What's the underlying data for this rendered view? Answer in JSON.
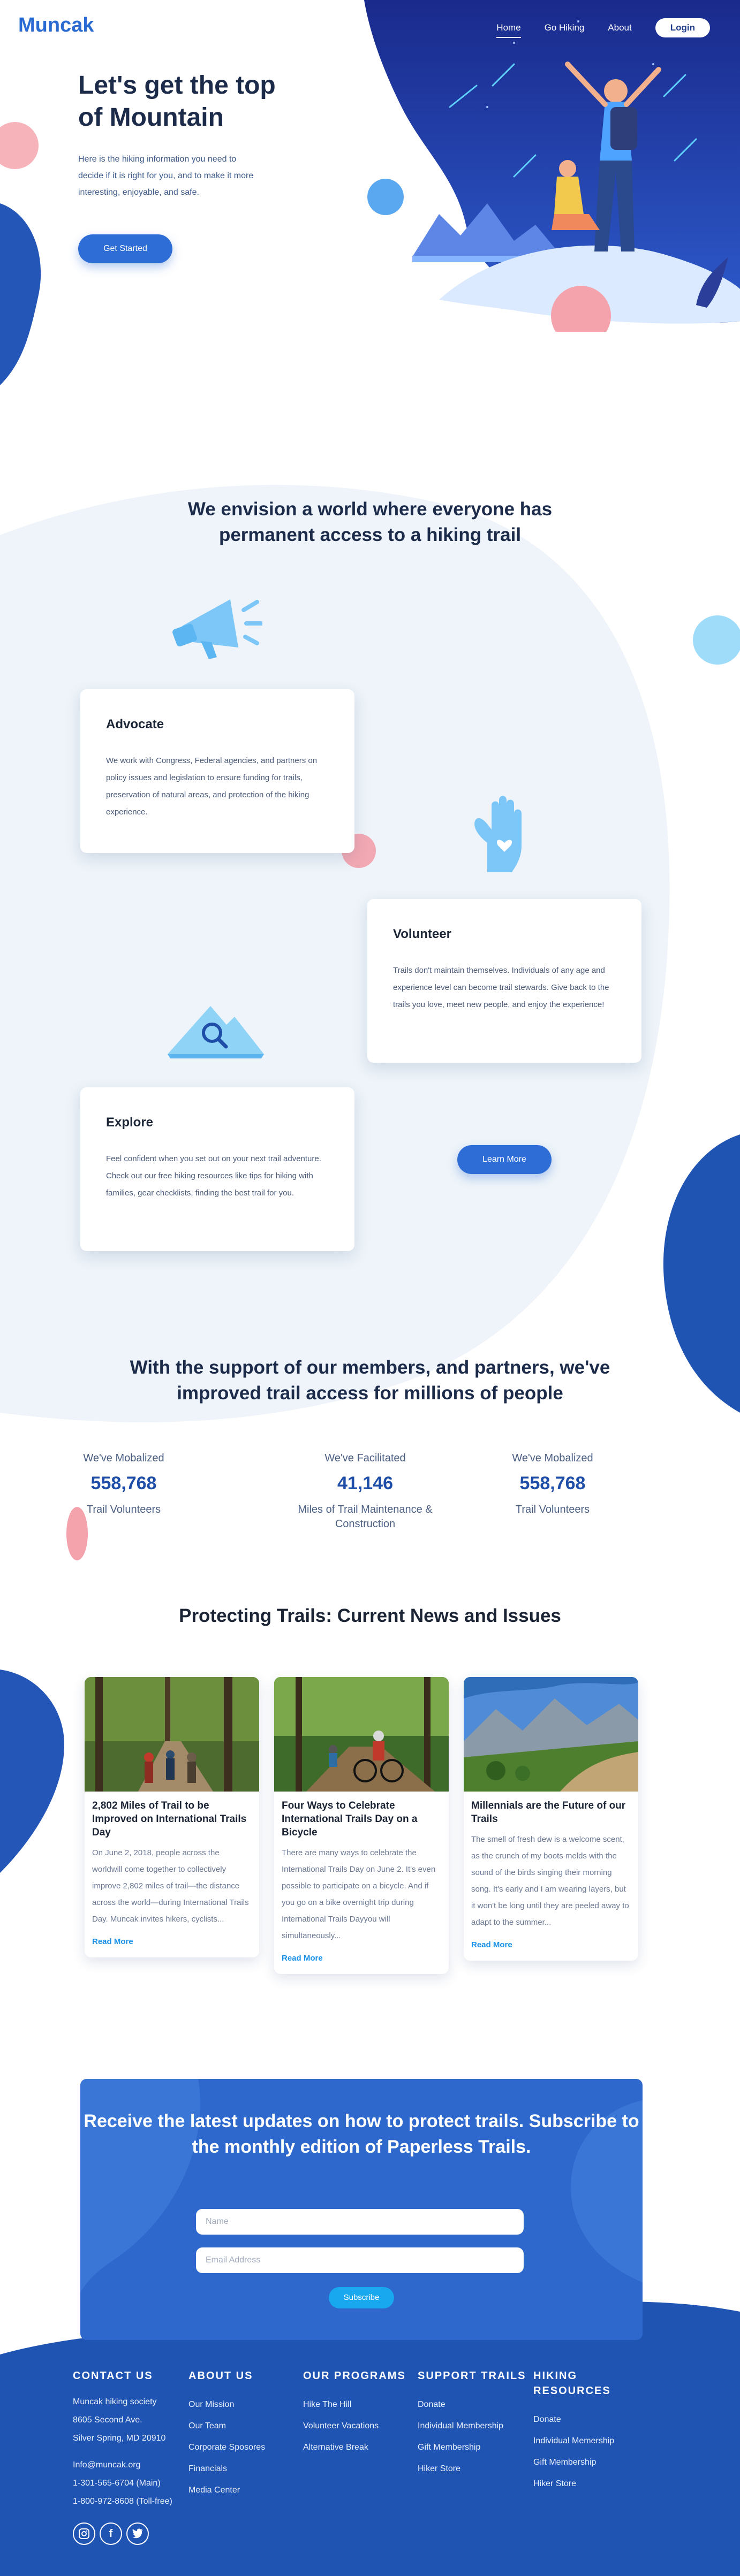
{
  "brand": {
    "name": "Muncak"
  },
  "nav": {
    "items": [
      {
        "label": "Home",
        "active": true
      },
      {
        "label": "Go Hiking"
      },
      {
        "label": "About"
      }
    ],
    "login_label": "Login"
  },
  "hero": {
    "title": "Let's get the top of Mountain",
    "subtitle": "Here is the hiking information you need to decide if it is right for you, and to make it more interesting, enjoyable, and safe.",
    "cta_label": "Get Started"
  },
  "vision": {
    "title": "We envision a world where everyone has permanent access to a hiking trail",
    "cards": [
      {
        "title": "Advocate",
        "text": "We work with Congress, Federal agencies, and partners on policy issues and legislation to ensure funding for trails, preservation of natural areas, and protection of the hiking experience.",
        "icon": "megaphone-icon"
      },
      {
        "title": "Volunteer",
        "text": "Trails don't maintain themselves. Individuals of any age and experience level can become trail stewards. Give back to the trails you love, meet new people, and enjoy the experience!",
        "icon": "heart-hand-icon"
      },
      {
        "title": "Explore",
        "text": "Feel confident when you set out on your next trail adventure. Check out our free hiking resources like tips for hiking with families, gear checklists, finding the best trail for you.",
        "icon": "mountain-search-icon"
      }
    ],
    "learn_more_label": "Learn More"
  },
  "support": {
    "title": "With the support of our members, and partners, we've improved trail access for millions of people",
    "stats": [
      {
        "pre": "We've Mobalized",
        "value": "558,768",
        "post": "Trail Volunteers"
      },
      {
        "pre": "We've Facilitated",
        "value": "41,146",
        "post": "Miles of Trail Maintenance & Construction"
      },
      {
        "pre": "We've Mobalized",
        "value": "558,768",
        "post": "Trail Volunteers"
      }
    ]
  },
  "news": {
    "title": "Protecting Trails: Current News and Issues",
    "articles": [
      {
        "title": "2,802 Miles of Trail to be Improved on International Trails Day",
        "excerpt": "On June 2, 2018, people across the worldwill come together to collectively improve 2,802 miles of trail—the distance across the world—during International Trails Day. Muncak invites hikers, cyclists...",
        "link": "Read More"
      },
      {
        "title": "Four Ways to Celebrate International Trails Day on a Bicycle",
        "excerpt": "There are many ways to celebrate the International Trails Day on June 2. It's even possible to participate on a bicycle. And if you go on a bike overnight trip during International Trails Dayyou will simultaneously...",
        "link": "Read More"
      },
      {
        "title": "Millennials are the Future of our Trails",
        "excerpt": "The smell of fresh dew is a welcome scent, as the crunch of my boots melds with the sound of the birds singing their morning song. It's early and I am wearing layers, but it won't be long until they are peeled away to adapt to the summer...",
        "link": "Read More"
      }
    ]
  },
  "subscribe": {
    "title": "Receive the latest updates on how to protect trails. Subscribe to the monthly edition of Paperless Trails.",
    "name_placeholder": "Name",
    "email_placeholder": "Email Address",
    "button_label": "Subscribe"
  },
  "footer": {
    "contact": {
      "title": "CONTACT US",
      "lines": [
        "Muncak hiking society",
        "8605 Second Ave.",
        "Silver Spring, MD 20910"
      ],
      "lines2": [
        "Info@muncak.org",
        "1-301-565-6704 (Main)",
        "1-800-972-8608 (Toll-free)"
      ],
      "socials": [
        "instagram-icon",
        "facebook-icon",
        "twitter-icon"
      ]
    },
    "columns": [
      {
        "title": "ABOUT US",
        "links": [
          "Our Mission",
          "Our Team",
          "Corporate Sposores",
          "Financials",
          "Media Center"
        ]
      },
      {
        "title": "OUR PROGRAMS",
        "links": [
          "Hike The Hill",
          "Volunteer Vacations",
          "Alternative Break"
        ]
      },
      {
        "title": "SUPPORT TRAILS",
        "links": [
          "Donate",
          "Individual Membership",
          "Gift Membership",
          "Hiker Store"
        ]
      },
      {
        "title": "HIKING RESOURCES",
        "links": [
          "Donate",
          "Individual Memership",
          "Gift Membership",
          "Hiker Store"
        ]
      }
    ]
  },
  "colors": {
    "primary": "#2f6dd6",
    "dark_blue": "#1e4ea8",
    "footer_blue": "#1f54b3",
    "accent_cyan": "#17a8f0",
    "pink": "#f4a3ad",
    "light_blue": "#8fd3f7",
    "pale_bg": "#eef4f9"
  }
}
